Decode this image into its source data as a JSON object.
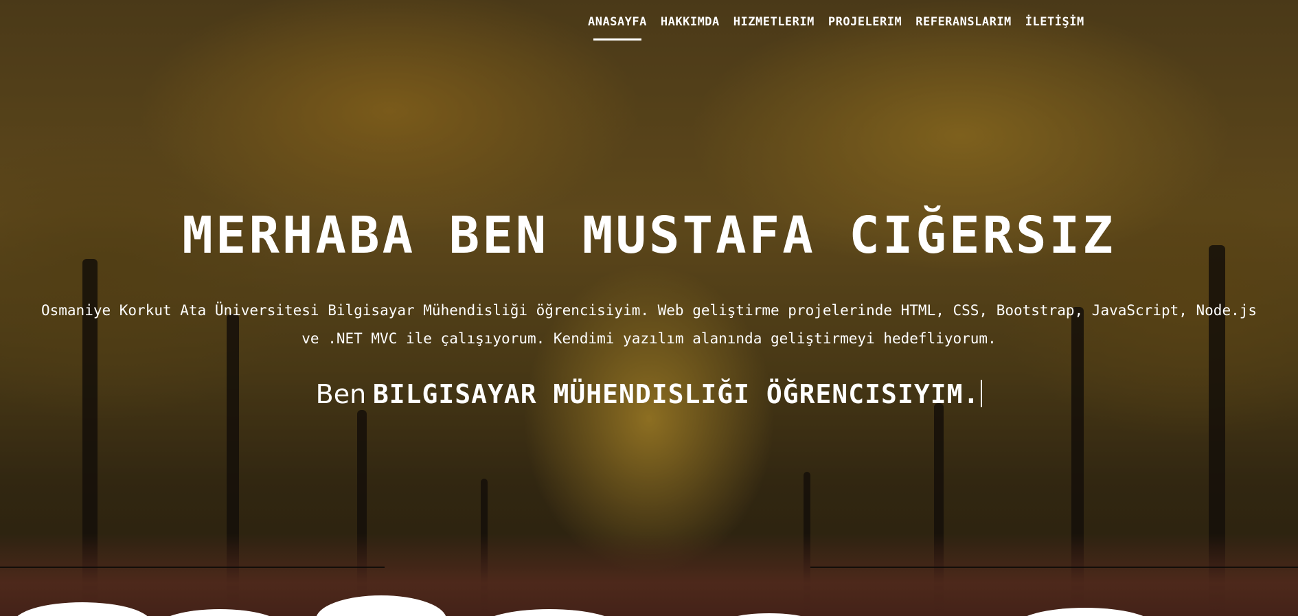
{
  "nav": {
    "items": [
      {
        "label": "ANASAYFA",
        "active": true
      },
      {
        "label": "HAKKIMDA",
        "active": false
      },
      {
        "label": "HIZMETLERIM",
        "active": false
      },
      {
        "label": "PROJELERIM",
        "active": false
      },
      {
        "label": "REFERANSLARIM",
        "active": false
      },
      {
        "label": "İLETİŞİM",
        "active": false
      }
    ]
  },
  "hero": {
    "title": "MERHABA BEN MUSTAFA CIĞERSIZ",
    "description_line1": "Osmaniye Korkut Ata Üniversitesi Bilgisayar Mühendisliği öğrencisiyim. Web geliştirme projelerinde HTML, CSS, Bootstrap, JavaScript, Node.js",
    "description_line2": "ve .NET MVC ile çalışıyorum. Kendimi yazılım alanında geliştirmeyi hedefliyorum.",
    "typed_prefix": "Ben",
    "typed_role": "BILGISAYAR MÜHENDISLIĞI ÖĞRENCISIYIM."
  },
  "colors": {
    "text": "#ffffff",
    "accent_underline": "#ffffff"
  }
}
